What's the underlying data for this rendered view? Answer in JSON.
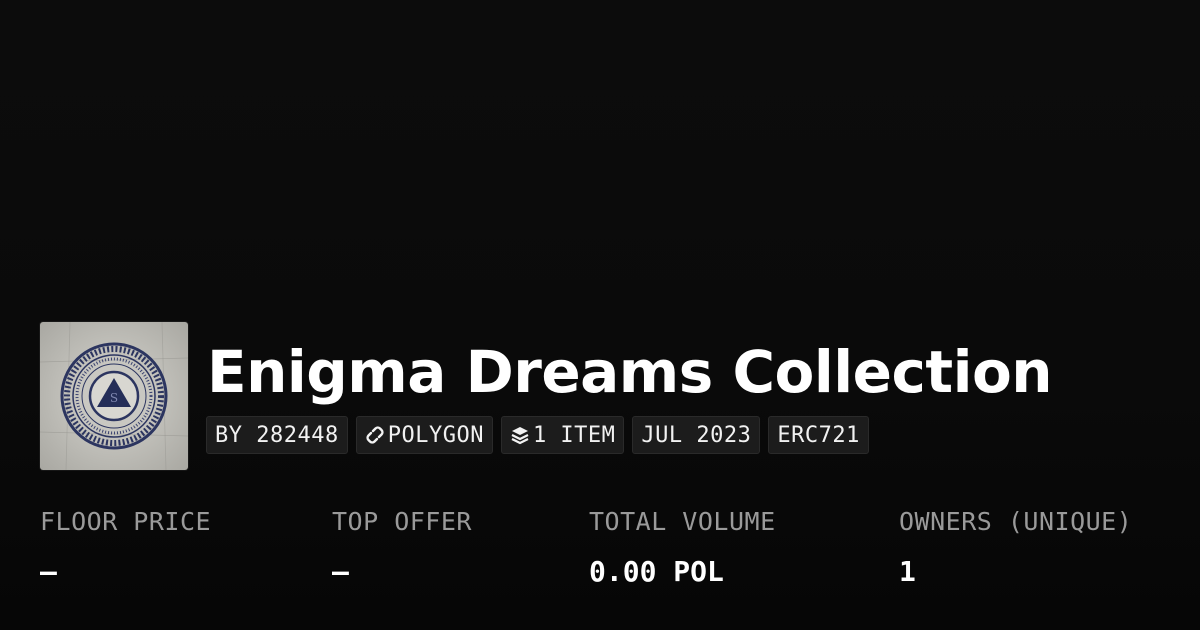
{
  "collection": {
    "title": "Enigma Dreams Collection",
    "thumbnail_icon": "collection-artwork",
    "thumbnail_letter": "S"
  },
  "badges": {
    "creator": "BY 282448",
    "chain": "POLYGON",
    "chain_icon": "chain-link-icon",
    "items": "1 ITEM",
    "items_icon": "layers-icon",
    "date": "JUL 2023",
    "standard": "ERC721"
  },
  "stats": [
    {
      "label": "FLOOR PRICE",
      "value": "—"
    },
    {
      "label": "TOP OFFER",
      "value": "—"
    },
    {
      "label": "TOTAL VOLUME",
      "value": "0.00 POL"
    },
    {
      "label": "OWNERS (UNIQUE)",
      "value": "1"
    }
  ],
  "colors": {
    "background": "#0a0a0a",
    "badge_background": "#1c1c1c",
    "label_gray": "#9a9a9a",
    "text_white": "#ffffff",
    "artwork_navy": "#26305a"
  }
}
